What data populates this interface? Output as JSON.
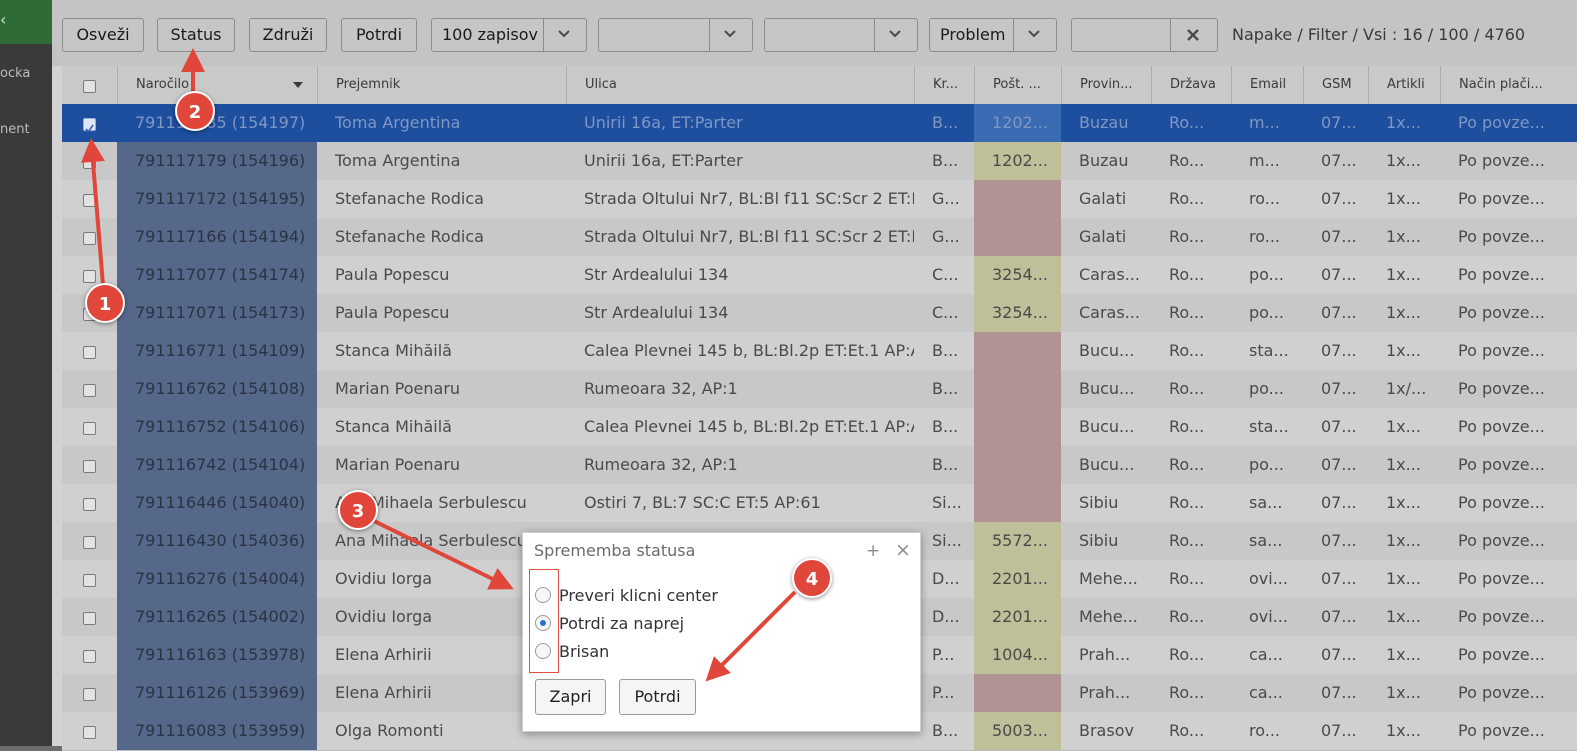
{
  "sidebar": {
    "items": [
      "ocka",
      "nent"
    ],
    "top_marker": "‹"
  },
  "toolbar": {
    "refresh_label": "Osveži",
    "status_label": "Status",
    "merge_label": "Združi",
    "confirm_label": "Potrdi",
    "page_size_value": "100 zapisov",
    "filter2_value": "",
    "filter3_value": "",
    "problem_value": "Problem",
    "search_value": "",
    "counter_text": "Napake / Filter / Vsi : 16 / 100 / 4760"
  },
  "table": {
    "headers": [
      "Naročilo",
      "Prejemnik",
      "Ulica",
      "Kr...",
      "Pošt. ...",
      "Provin...",
      "Država",
      "Email",
      "GSM",
      "Artikli",
      "Način plači..."
    ],
    "rows": [
      {
        "id": "791117185 (154197)",
        "name": "Toma Argentina",
        "street": "Unirii 16a, ET:Parter",
        "kr": "B...",
        "post": "1202...",
        "post_status": "green",
        "prov": "Buzau",
        "drz": "Ro...",
        "email": "m...",
        "gsm": "07...",
        "art": "1x...",
        "pay": "Po povze...",
        "selected": true
      },
      {
        "id": "791117179 (154196)",
        "name": "Toma Argentina",
        "street": "Unirii 16a, ET:Parter",
        "kr": "B...",
        "post": "1202...",
        "post_status": "green",
        "prov": "Buzau",
        "drz": "Ro...",
        "email": "m...",
        "gsm": "07...",
        "art": "1x...",
        "pay": "Po povze...",
        "selected": false
      },
      {
        "id": "791117172 (154195)",
        "name": "Stefanache Rodica",
        "street": "Strada Oltului Nr7, BL:Bl f11 SC:Scr 2 ET:P...",
        "kr": "G...",
        "post": "",
        "post_status": "red",
        "prov": "Galati",
        "drz": "Ro...",
        "email": "ro...",
        "gsm": "07...",
        "art": "1x...",
        "pay": "Po povze...",
        "selected": false
      },
      {
        "id": "791117166 (154194)",
        "name": "Stefanache Rodica",
        "street": "Strada Oltului Nr7, BL:Bl f11 SC:Scr 2 ET:P...",
        "kr": "G...",
        "post": "",
        "post_status": "red",
        "prov": "Galati",
        "drz": "Ro...",
        "email": "ro...",
        "gsm": "07...",
        "art": "1x...",
        "pay": "Po povze...",
        "selected": false
      },
      {
        "id": "791117077 (154174)",
        "name": "Paula Popescu",
        "street": "Str Ardealului 134",
        "kr": "C...",
        "post": "3254...",
        "post_status": "green",
        "prov": "Caras...",
        "drz": "Ro...",
        "email": "po...",
        "gsm": "07...",
        "art": "1x...",
        "pay": "Po povze...",
        "selected": false
      },
      {
        "id": "791117071 (154173)",
        "name": "Paula Popescu",
        "street": "Str Ardealului 134",
        "kr": "C...",
        "post": "3254...",
        "post_status": "green",
        "prov": "Caras...",
        "drz": "Ro...",
        "email": "po...",
        "gsm": "07...",
        "art": "1x...",
        "pay": "Po povze...",
        "selected": false
      },
      {
        "id": "791116771 (154109)",
        "name": "Stanca Mihăilă",
        "street": "Calea Plevnei 145 b, BL:Bl.2p ET:Et.1 AP:A...",
        "kr": "B...",
        "post": "",
        "post_status": "red",
        "prov": "Bucu...",
        "drz": "Ro...",
        "email": "sta...",
        "gsm": "07...",
        "art": "1x...",
        "pay": "Po povze...",
        "selected": false
      },
      {
        "id": "791116762 (154108)",
        "name": "Marian Poenaru",
        "street": "Rumeoara 32, AP:1",
        "kr": "B...",
        "post": "",
        "post_status": "red",
        "prov": "Bucu...",
        "drz": "Ro...",
        "email": "po...",
        "gsm": "07...",
        "art": "1x/...",
        "pay": "Po povze...",
        "selected": false
      },
      {
        "id": "791116752 (154106)",
        "name": "Stanca Mihăilă",
        "street": "Calea Plevnei 145 b, BL:Bl.2p ET:Et.1 AP:A...",
        "kr": "B...",
        "post": "",
        "post_status": "red",
        "prov": "Bucu...",
        "drz": "Ro...",
        "email": "sta...",
        "gsm": "07...",
        "art": "1x...",
        "pay": "Po povze...",
        "selected": false
      },
      {
        "id": "791116742 (154104)",
        "name": "Marian Poenaru",
        "street": "Rumeoara 32, AP:1",
        "kr": "B...",
        "post": "",
        "post_status": "red",
        "prov": "Bucu...",
        "drz": "Ro...",
        "email": "po...",
        "gsm": "07...",
        "art": "1x...",
        "pay": "Po povze...",
        "selected": false
      },
      {
        "id": "791116446 (154040)",
        "name": "Ana Mihaela Serbulescu",
        "street": "Ostiri 7, BL:7 SC:C ET:5 AP:61",
        "kr": "Si...",
        "post": "",
        "post_status": "red",
        "prov": "Sibiu",
        "drz": "Ro...",
        "email": "sa...",
        "gsm": "07...",
        "art": "1x...",
        "pay": "Po povze...",
        "selected": false
      },
      {
        "id": "791116430 (154036)",
        "name": "Ana Mihaela Serbulescu",
        "street": "",
        "kr": "Si...",
        "post": "5572...",
        "post_status": "green",
        "prov": "Sibiu",
        "drz": "Ro...",
        "email": "sa...",
        "gsm": "07...",
        "art": "1x...",
        "pay": "Po povze...",
        "selected": false
      },
      {
        "id": "791116276 (154004)",
        "name": "Ovidiu Iorga",
        "street": "",
        "kr": "D...",
        "post": "2201...",
        "post_status": "green",
        "prov": "Mehe...",
        "drz": "Ro...",
        "email": "ovi...",
        "gsm": "07...",
        "art": "1x...",
        "pay": "Po povze...",
        "selected": false
      },
      {
        "id": "791116265 (154002)",
        "name": "Ovidiu Iorga",
        "street": "",
        "kr": "D...",
        "post": "2201...",
        "post_status": "green",
        "prov": "Mehe...",
        "drz": "Ro...",
        "email": "ovi...",
        "gsm": "07...",
        "art": "1x...",
        "pay": "Po povze...",
        "selected": false
      },
      {
        "id": "791116163 (153978)",
        "name": "Elena Arhirii",
        "street": "",
        "kr": "P...",
        "post": "1004...",
        "post_status": "green",
        "prov": "Prah...",
        "drz": "Ro...",
        "email": "ca...",
        "gsm": "07...",
        "art": "1x...",
        "pay": "Po povze...",
        "selected": false
      },
      {
        "id": "791116126 (153969)",
        "name": "Elena Arhirii",
        "street": "",
        "kr": "P...",
        "post": "",
        "post_status": "red",
        "prov": "Prah...",
        "drz": "Ro...",
        "email": "ca...",
        "gsm": "07...",
        "art": "1x...",
        "pay": "Po povze...",
        "selected": false
      },
      {
        "id": "791116083 (153959)",
        "name": "Olga Romonti",
        "street": "",
        "kr": "B...",
        "post": "5003...",
        "post_status": "green",
        "prov": "Brasov",
        "drz": "Ro...",
        "email": "ro...",
        "gsm": "07...",
        "art": "1x...",
        "pay": "Po povze...",
        "selected": false
      }
    ]
  },
  "dialog": {
    "title": "Sprememba statusa",
    "options": [
      "Preveri klicni center",
      "Potrdi za naprej",
      "Brisan"
    ],
    "selected_option": 1,
    "close_label": "Zapri",
    "confirm_label": "Potrdi",
    "expand_icon": "+",
    "close_icon": "×"
  },
  "annotations": [
    "1",
    "2",
    "3",
    "4"
  ],
  "colors": {
    "annotation": "#e0463a",
    "selected_row": "#1d4f9e",
    "radio_selected": "#2a6fd6"
  }
}
